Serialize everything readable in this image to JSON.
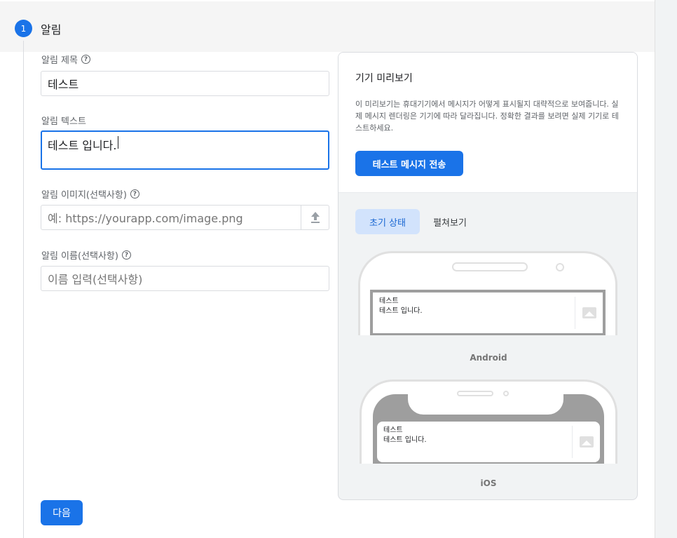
{
  "step": {
    "number": "1",
    "title": "알림"
  },
  "form": {
    "title_label": "알림 제목",
    "title_value": "테스트",
    "text_label": "알림 텍스트",
    "text_value": "테스트 입니다.",
    "image_label": "알림 이미지(선택사항)",
    "image_placeholder": "예: https://yourapp.com/image.png",
    "name_label": "알림 이름(선택사항)",
    "name_placeholder": "이름 입력(선택사항)",
    "help_glyph": "?"
  },
  "next_label": "다음",
  "preview": {
    "title": "기기 미리보기",
    "description": "이 미리보기는 휴대기기에서 메시지가 어떻게 표시될지 대략적으로 보여줍니다. 실제 메시지 렌더링은 기기에 따라 달라집니다. 정확한 결과를 보려면 실제 기기로 테스트하세요.",
    "send_test_label": "테스트 메시지 전송",
    "tabs": [
      {
        "label": "초기 상태",
        "selected": true
      },
      {
        "label": "펼쳐보기",
        "selected": false
      }
    ],
    "android": {
      "label": "Android",
      "notif_title": "테스트",
      "notif_body": "테스트 입니다."
    },
    "ios": {
      "label": "iOS",
      "notif_title": "테스트",
      "notif_body": "테스트 입니다."
    }
  },
  "icons": {
    "help": "help-circle-icon",
    "upload": "upload-icon",
    "image": "image-icon"
  },
  "colors": {
    "accent": "#1a73e8",
    "tab_selected_bg": "#d2e3fc",
    "header_bg": "#f5f5f5"
  }
}
